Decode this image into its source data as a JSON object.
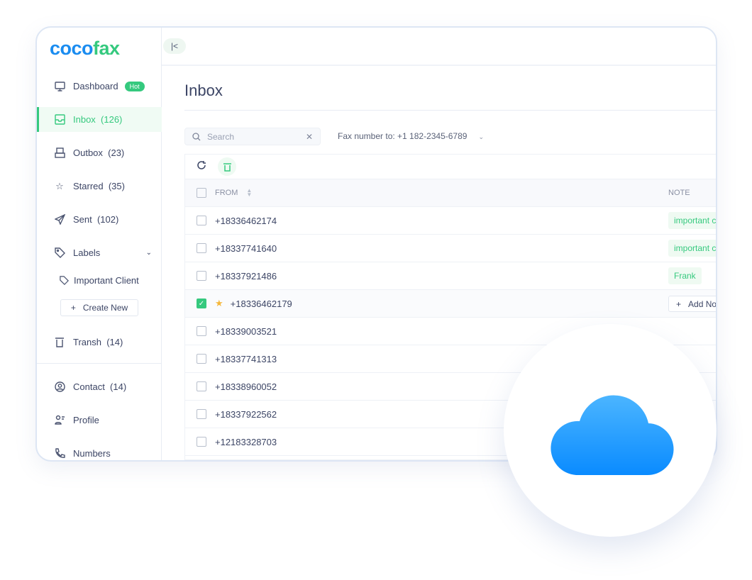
{
  "brand": {
    "part1": "coco",
    "part2": "fax"
  },
  "sidebar": {
    "items": [
      {
        "label": "Dashboard",
        "badge": "Hot",
        "icon": "monitor-icon"
      },
      {
        "label": "Inbox  (126)",
        "icon": "inbox-icon",
        "active": true
      },
      {
        "label": "Outbox  (23)",
        "icon": "outbox-icon"
      },
      {
        "label": "Starred  (35)",
        "icon": "star-icon"
      },
      {
        "label": "Sent  (102)",
        "icon": "send-icon"
      },
      {
        "label": "Labels",
        "icon": "tag-icon"
      },
      {
        "label": "Important Client",
        "icon": "tag-icon"
      },
      {
        "label": "Transh  (14)",
        "icon": "trash-icon"
      },
      {
        "label": "Contact  (14)",
        "icon": "user-circle-icon"
      },
      {
        "label": "Profile",
        "icon": "profile-icon"
      },
      {
        "label": "Numbers",
        "icon": "phone-icon"
      }
    ],
    "create_new": "Create New"
  },
  "main": {
    "title": "Inbox",
    "search_placeholder": "Search",
    "fax_filter": "Fax number to: +1 182-2345-6789",
    "columns": {
      "from": "FROM",
      "note": "NOTE"
    },
    "rows": [
      {
        "from": "+18336462174",
        "note": "important c"
      },
      {
        "from": "+18337741640",
        "note": "important c"
      },
      {
        "from": "+18337921486",
        "note": "Frank"
      },
      {
        "from": "+18336462179",
        "checked": true,
        "starred": true,
        "add_note": "Add No"
      },
      {
        "from": "+18339003521"
      },
      {
        "from": "+18337741313"
      },
      {
        "from": "+18338960052"
      },
      {
        "from": "+18337922562"
      },
      {
        "from": "+12183328703"
      }
    ]
  },
  "colors": {
    "accent": "#35c97e",
    "brand_blue": "#1a8cf0",
    "cloud": "#1a96ff"
  }
}
